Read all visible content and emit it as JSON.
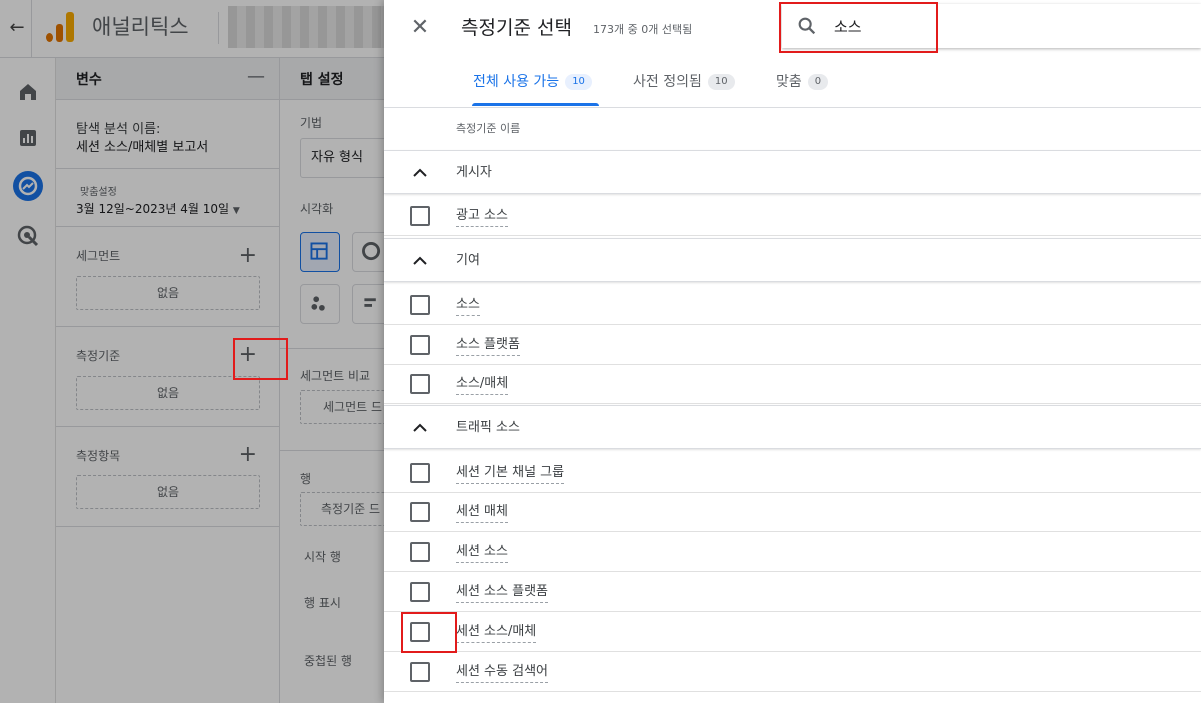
{
  "app": {
    "title": "애널리틱스"
  },
  "variables_panel": {
    "heading": "변수",
    "exploration_label": "탐색 분석 이름:",
    "exploration_name": "세션 소스/매체별 보고서",
    "date_label": "맞춤설정",
    "date_range": "3월 12일~2023년 4월 10일",
    "segments_label": "세그먼트",
    "segments_value": "없음",
    "dimensions_label": "측정기준",
    "dimensions_value": "없음",
    "metrics_label": "측정항목",
    "metrics_value": "없음"
  },
  "tab_settings": {
    "heading": "탭 설정",
    "technique_label": "기법",
    "technique_value": "자유 형식",
    "visualization_label": "시각화",
    "segment_compare_label": "세그먼트 비교",
    "segment_drop": "세그먼트 드",
    "rows_label": "행",
    "dimension_drop": "측정기준 드",
    "start_row_label": "시작 행",
    "show_rows_label": "행 표시",
    "nested_rows_label": "중첩된 행"
  },
  "dialog": {
    "title": "측정기준 선택",
    "subtitle": "173개 중 0개 선택됨",
    "search_value": "소스",
    "column_header": "측정기준 이름",
    "tabs": [
      {
        "label": "전체 사용 가능",
        "count": "10"
      },
      {
        "label": "사전 정의됨",
        "count": "10"
      },
      {
        "label": "맞춤",
        "count": "0"
      }
    ],
    "groups": [
      {
        "label": "게시자",
        "items": [
          "광고 소스"
        ]
      },
      {
        "label": "기여",
        "items": [
          "소스",
          "소스 플랫폼",
          "소스/매체"
        ]
      },
      {
        "label": "트래픽 소스",
        "items": [
          "세션 기본 채널 그룹",
          "세션 매체",
          "세션 소스",
          "세션 소스 플랫폼",
          "세션 소스/매체",
          "세션 수동 검색어"
        ]
      }
    ]
  },
  "colors": {
    "accent": "#1a73e8",
    "highlight": "#e21b1b",
    "logo": "#f9ab00"
  }
}
